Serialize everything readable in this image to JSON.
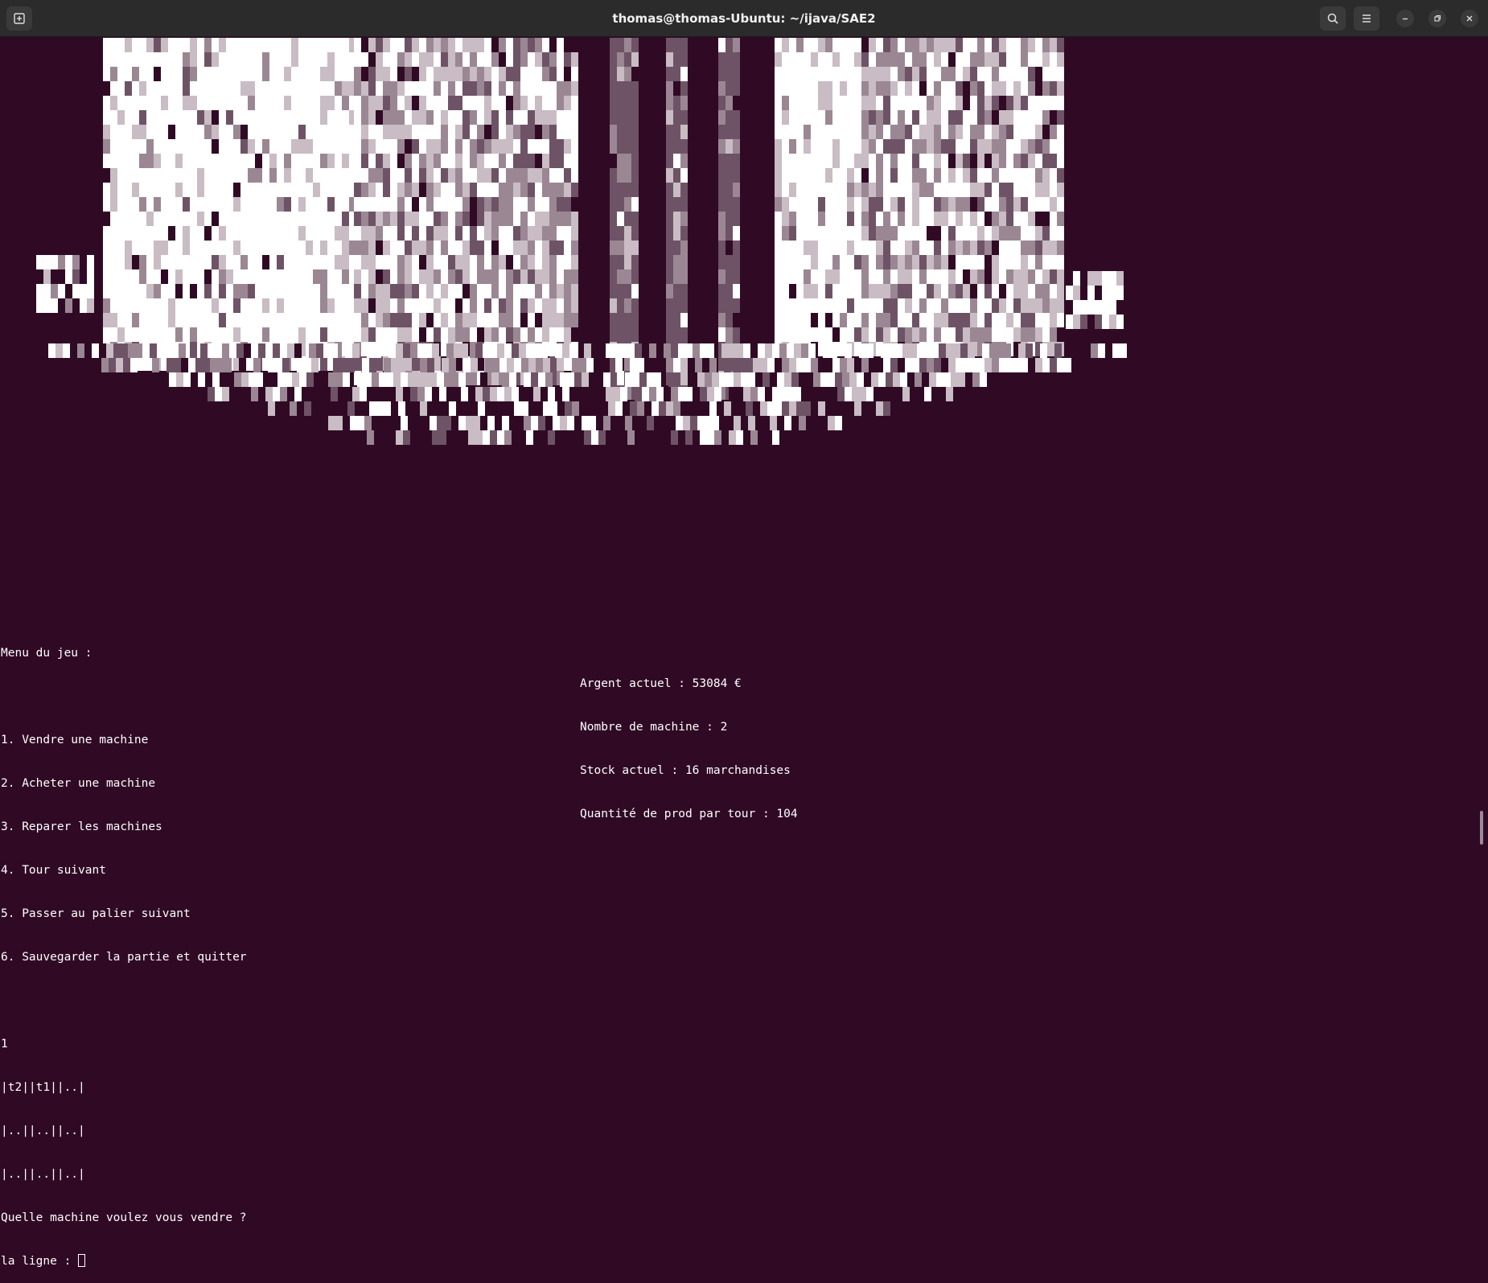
{
  "window": {
    "title": "thomas@thomas-Ubuntu: ~/ijava/SAE2",
    "icons": [
      "new-tab-icon",
      "search-icon",
      "hamburger-menu-icon",
      "minimize-icon",
      "restore-icon",
      "close-icon"
    ]
  },
  "colors": {
    "background": "#300a24",
    "titlebar": "#2b2b2b",
    "art_palette": [
      "#ffffff",
      "#c9bcc4",
      "#9b8794",
      "#6e5366",
      "#300a24"
    ]
  },
  "menu": {
    "heading": "Menu du jeu :",
    "items": [
      "1. Vendre une machine",
      "2. Acheter une machine",
      "3. Reparer les machines",
      "4. Tour suivant",
      "5. Passer au palier suivant",
      "6. Sauvegarder la partie et quitter"
    ]
  },
  "stats": [
    "Argent actuel : 53084 €",
    "Nombre de machine : 2",
    "Stock actuel : 16 marchandises",
    "Quantité de prod par tour : 104"
  ],
  "session": {
    "input_choice": "1",
    "grid": [
      "|t2||t1||..|",
      "|..||..||..|",
      "|..||..||..|"
    ],
    "question": "Quelle machine voulez vous vendre ?",
    "prompt": "la ligne : "
  }
}
